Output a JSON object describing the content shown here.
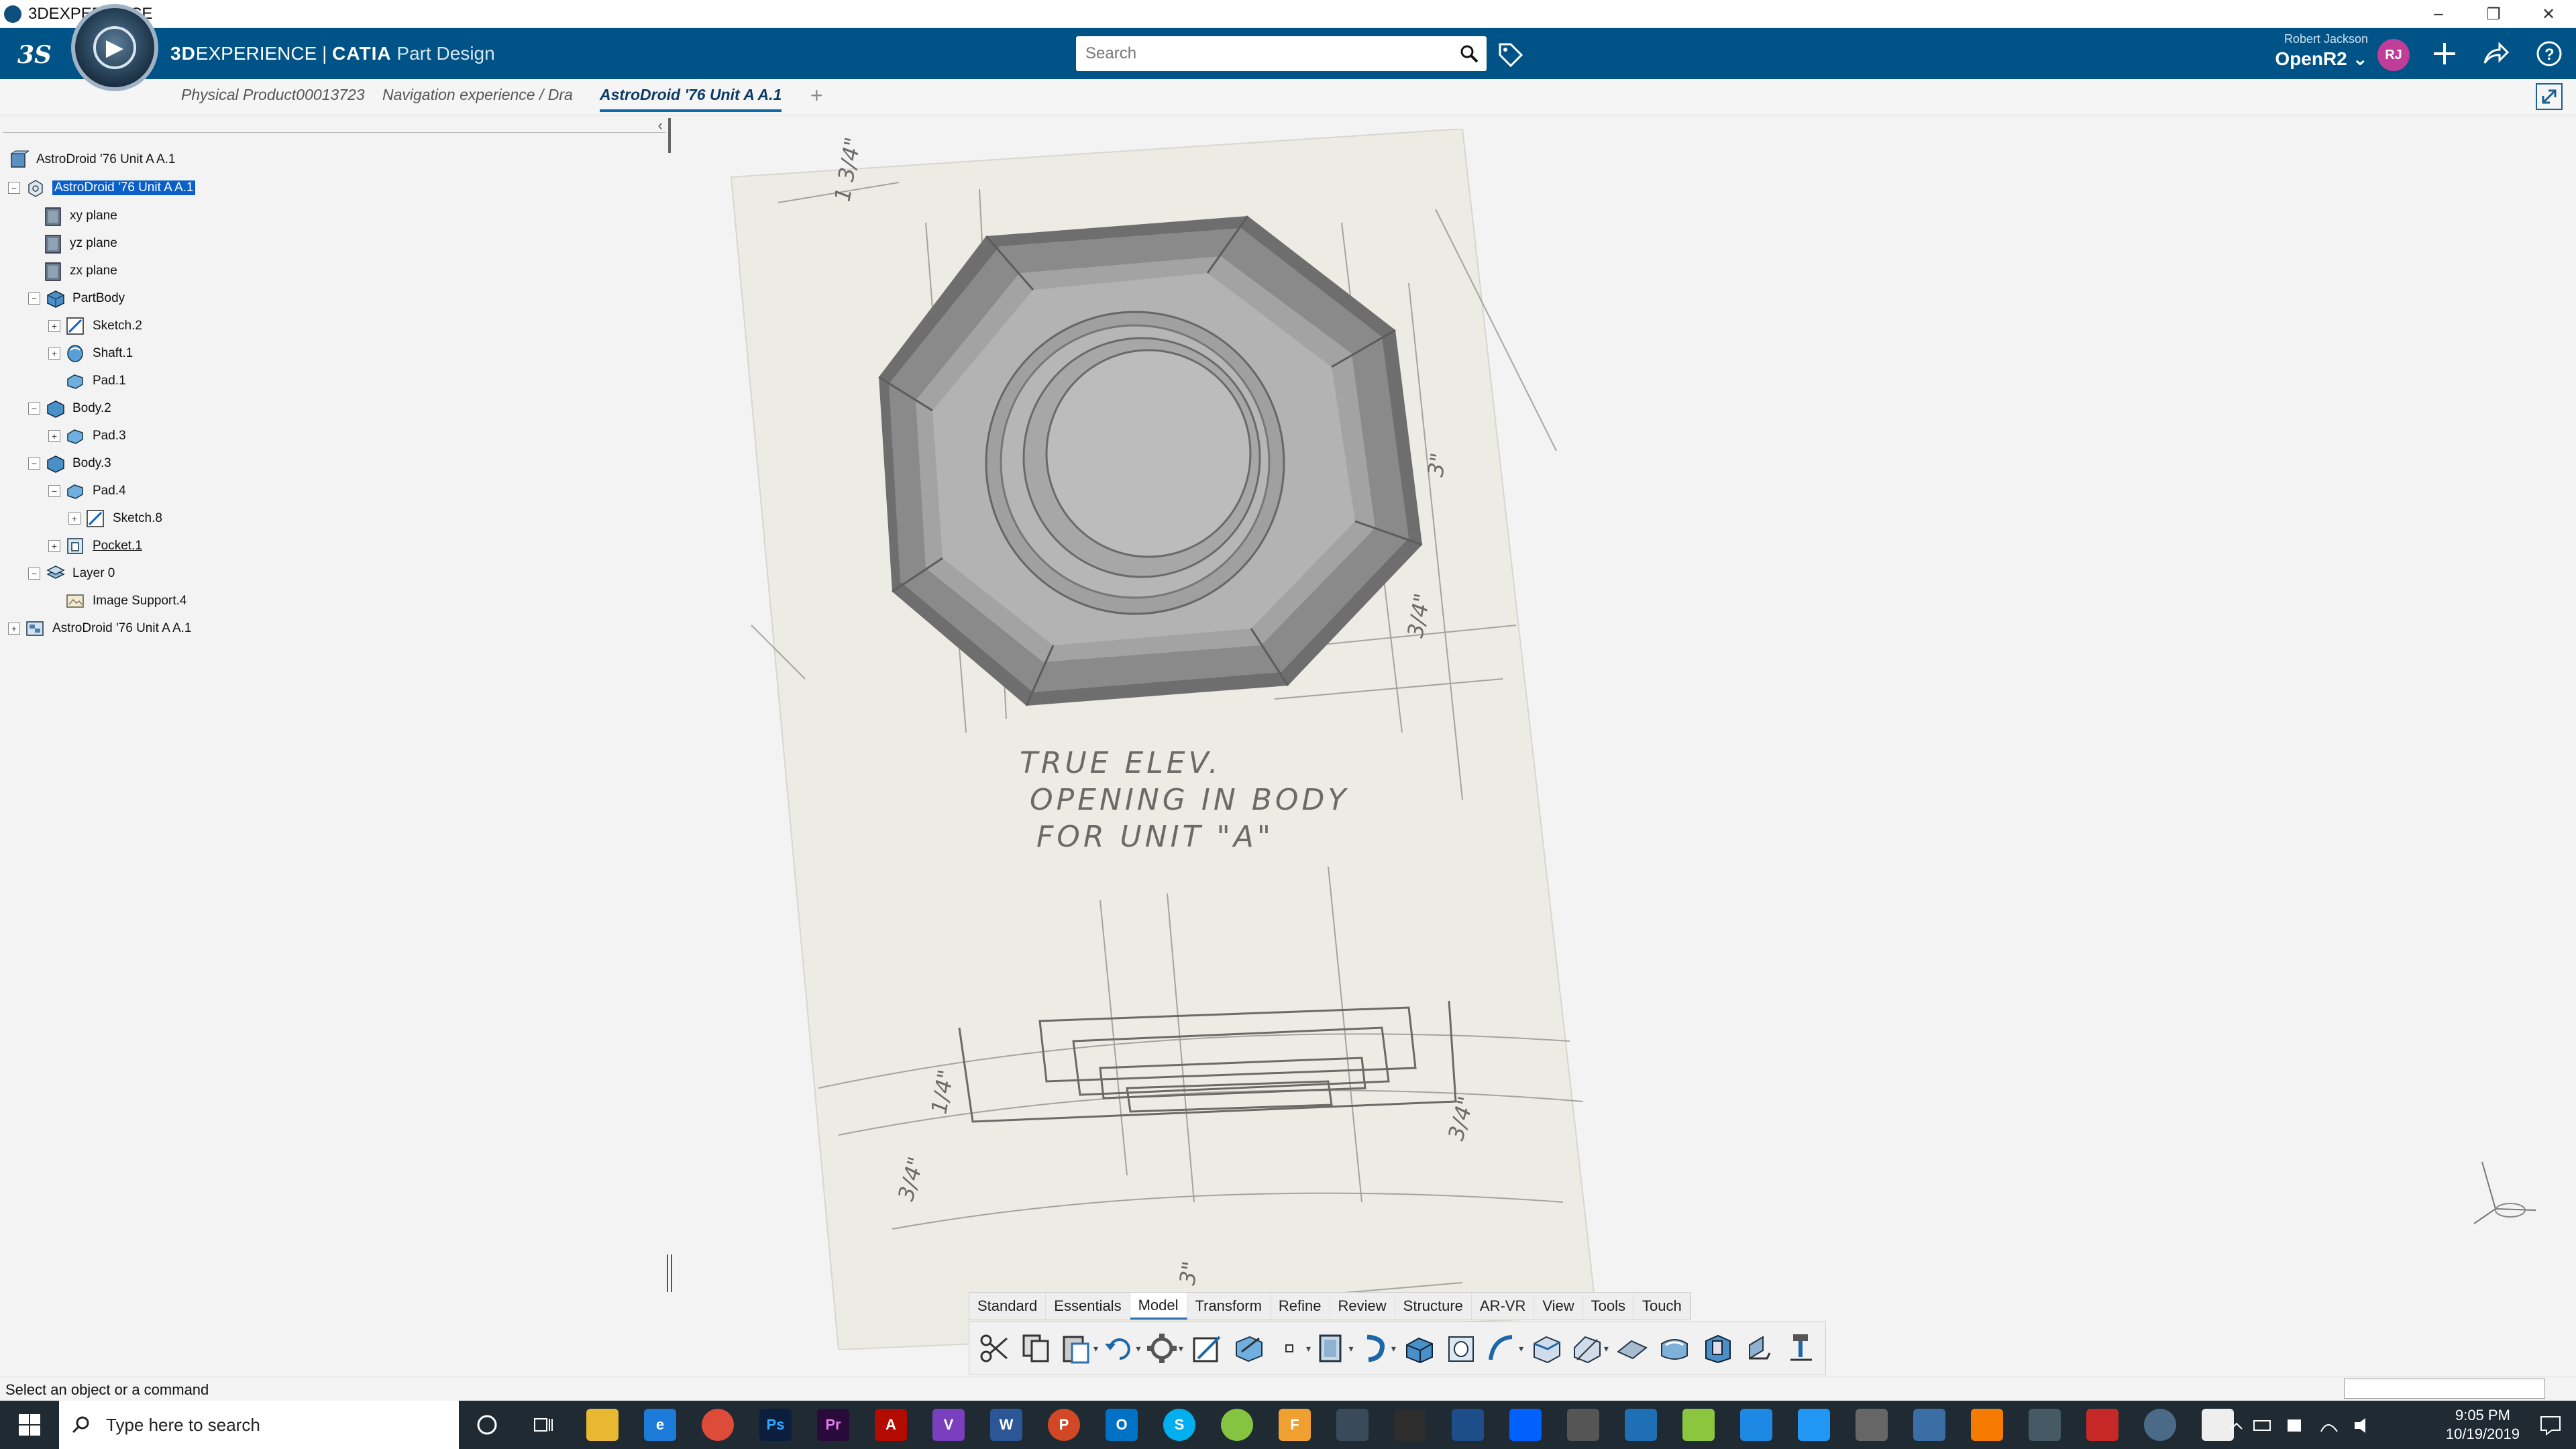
{
  "window": {
    "title": "3DEXPERIENCE",
    "controls": [
      "–",
      "❐",
      "✕"
    ]
  },
  "topbar": {
    "brand_bold": "3D",
    "brand_rest": "EXPERIENCE",
    "brand_separator": " | ",
    "brand_app": "CATIA",
    "brand_module": "Part Design",
    "search_placeholder": "Search",
    "user_name": "Robert Jackson",
    "space_name": "OpenR2",
    "avatar_initials": "RJ",
    "colors": {
      "bar": "#005386",
      "avatar": "#c03d9a"
    }
  },
  "tabs": [
    {
      "label": "Physical Product00013723"
    },
    {
      "label": "Navigation experience / Dra"
    },
    {
      "label": "AstroDroid '76 Unit A A.1"
    }
  ],
  "tab_add": "+",
  "tree": {
    "collapse_glyph": "‹",
    "rows": [
      {
        "label": "AstroDroid '76 Unit A A.1",
        "icon": "product-icon"
      },
      {
        "label": "AstroDroid '76 Unit A A.1",
        "icon": "part-icon",
        "selected": true
      },
      {
        "label": "xy plane",
        "icon": "plane-icon"
      },
      {
        "label": "yz plane",
        "icon": "plane-icon"
      },
      {
        "label": "zx plane",
        "icon": "plane-icon"
      },
      {
        "label": "PartBody",
        "icon": "body-icon"
      },
      {
        "label": "Sketch.2",
        "icon": "sketch-icon"
      },
      {
        "label": "Shaft.1",
        "icon": "shaft-icon"
      },
      {
        "label": "Pad.1",
        "icon": "pad-icon"
      },
      {
        "label": "Body.2",
        "icon": "body-icon"
      },
      {
        "label": "Pad.3",
        "icon": "pad-icon"
      },
      {
        "label": "Body.3",
        "icon": "body-icon"
      },
      {
        "label": "Pad.4",
        "icon": "pad-icon"
      },
      {
        "label": "Sketch.8",
        "icon": "sketch-icon"
      },
      {
        "label": "Pocket.1",
        "icon": "pocket-icon"
      },
      {
        "label": "Layer 0",
        "icon": "layer-icon"
      },
      {
        "label": "Image Support.4",
        "icon": "image-support-icon"
      },
      {
        "label": "AstroDroid '76 Unit A A.1",
        "icon": "assembly-icon"
      }
    ]
  },
  "viewport": {
    "drawing_notes": [
      "TRUE ELEV.",
      "OPENING IN BODY",
      "FOR UNIT \"A\""
    ],
    "dimension_labels": [
      "1 3/4\"",
      "3\"",
      "3/4\"",
      "1/4\"",
      "3/4\"",
      "3/4\"",
      "3\""
    ]
  },
  "action_bar": {
    "sections": [
      "Standard",
      "Essentials",
      "Model",
      "Transform",
      "Refine",
      "Review",
      "Structure",
      "AR-VR",
      "View",
      "Tools",
      "Touch"
    ],
    "active_section": "Model",
    "tools": [
      "cut-icon",
      "copy-icon",
      "paste-icon",
      "undo-icon",
      "update-icon",
      "sketch-icon",
      "positioned-sketch-icon",
      "point-icon",
      "plane-icon",
      "shaft-icon",
      "pad-icon",
      "pocket-icon",
      "rib-icon",
      "fillet-icon",
      "chamfer-icon",
      "draft-icon",
      "shell-icon",
      "thickness-icon",
      "measure-icon"
    ]
  },
  "status": {
    "text": "Select an object or a command"
  },
  "taskbar": {
    "search_placeholder": "Type here to search",
    "time": "9:05 PM",
    "date": "10/19/2019"
  }
}
